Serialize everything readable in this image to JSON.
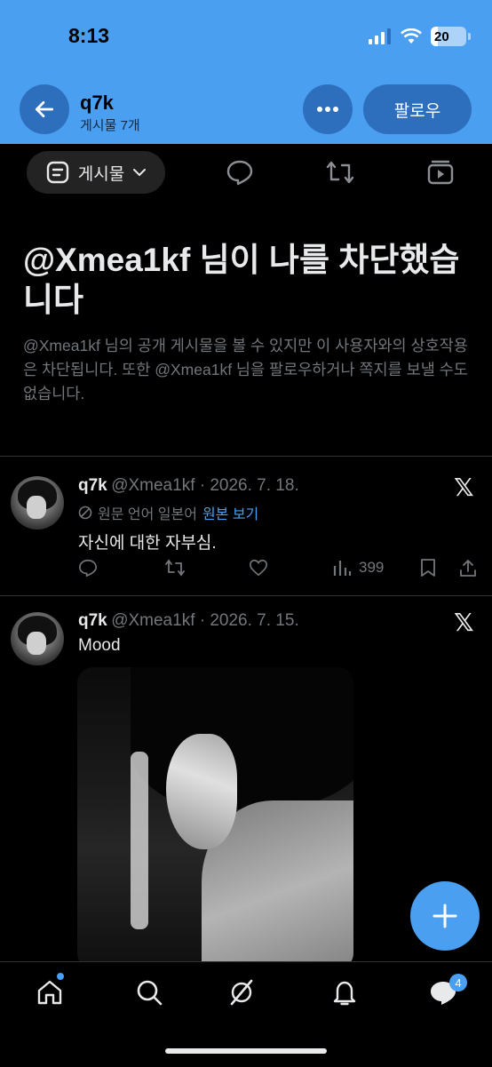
{
  "status_bar": {
    "time": "8:13",
    "battery": "20"
  },
  "header": {
    "name": "q7k",
    "post_count": "게시물 7개",
    "follow_label": "팔로우"
  },
  "tabs": {
    "posts_label": "게시물"
  },
  "blocked": {
    "title": "@Xmea1kf 님이 나를 차단했습니다",
    "description": "@Xmea1kf 님의 공개 게시물을 볼 수 있지만 이 사용자와의 상호작용은 차단됩니다. 또한 @Xmea1kf 님을 팔로우하거나 쪽지를 보낼 수도 없습니다."
  },
  "tweets": [
    {
      "name": "q7k",
      "handle_date": "@Xmea1kf · 2026. 7. 18.",
      "translate_note": "원문 언어 일본어",
      "translate_link": "원본 보기",
      "text": "자신에 대한 자부심.",
      "views": "399"
    },
    {
      "name": "q7k",
      "handle_date": "@Xmea1kf · 2026. 7. 15.",
      "text": "Mood"
    }
  ],
  "nav": {
    "messages_badge": "4"
  },
  "colors": {
    "accent": "#4a9ff0",
    "background": "#000000",
    "muted": "#71767b"
  },
  "icons": [
    "back-arrow-icon",
    "more-icon",
    "posts-icon",
    "chevron-down-icon",
    "reply-icon",
    "retweet-icon",
    "media-icon",
    "x-logo-icon",
    "like-icon",
    "views-icon",
    "bookmark-icon",
    "share-icon",
    "compose-icon",
    "home-icon",
    "search-icon",
    "grok-icon",
    "bell-icon",
    "messages-icon"
  ]
}
